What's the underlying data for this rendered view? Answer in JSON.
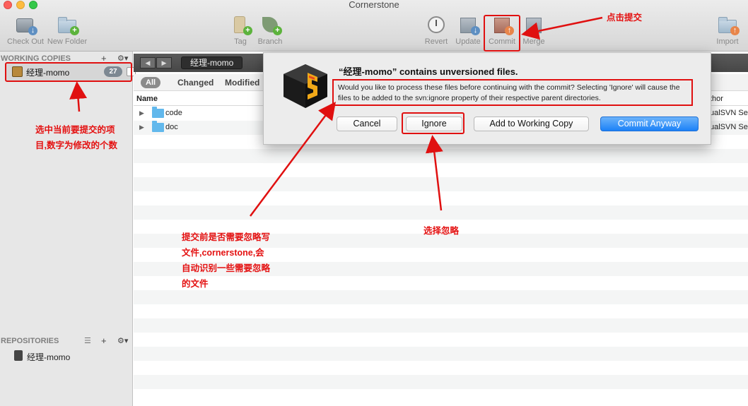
{
  "window": {
    "title": "Cornerstone"
  },
  "toolbar": {
    "check_out": "Check Out",
    "new_folder": "New Folder",
    "tag": "Tag",
    "branch": "Branch",
    "revert": "Revert",
    "update": "Update",
    "commit": "Commit",
    "merge": "Merge",
    "import": "Import"
  },
  "sidebar": {
    "working_copies_header": "WORKING COPIES",
    "repositories_header": "REPOSITORIES",
    "add_symbol": "+",
    "gear_symbol": "⚙▾",
    "list_symbol": "☰",
    "working_copy": {
      "name": "经理-momo",
      "count": "27"
    },
    "repository": {
      "name": "经理-momo"
    }
  },
  "navbar": {
    "back": "◀",
    "forward": "▶",
    "breadcrumb": "经理-momo"
  },
  "filters": {
    "all": "All",
    "changed": "Changed",
    "modified": "Modified"
  },
  "table": {
    "col_name": "Name",
    "col_author": "thor",
    "rows": [
      {
        "name": "code",
        "author": "ualSVN Se"
      },
      {
        "name": "doc",
        "author": "ualSVN Se"
      }
    ]
  },
  "dialog": {
    "title": "“经理-momo” contains unversioned files.",
    "message": "Would you like to process these files before continuing with the commit? Selecting 'Ignore' will cause the files to be added to the svn:ignore property of their respective parent directories.",
    "buttons": {
      "cancel": "Cancel",
      "ignore": "Ignore",
      "add": "Add to Working Copy",
      "commit_anyway": "Commit Anyway"
    }
  },
  "annotations": {
    "click_commit": "点击提交",
    "select_project_line1": "选中当前要提交的项",
    "select_project_line2": "目,数字为修改的个数",
    "choose_ignore": "选择忽略",
    "ignore_note_line1": "提交前是否需要忽略写",
    "ignore_note_line2": "文件,cornerstone,会",
    "ignore_note_line3": "自动识别一些需要忽略",
    "ignore_note_line4": "的文件"
  },
  "colors": {
    "annotation_red": "#e01010",
    "primary_button": "#1c81f7",
    "folder_blue": "#62b8ec"
  }
}
